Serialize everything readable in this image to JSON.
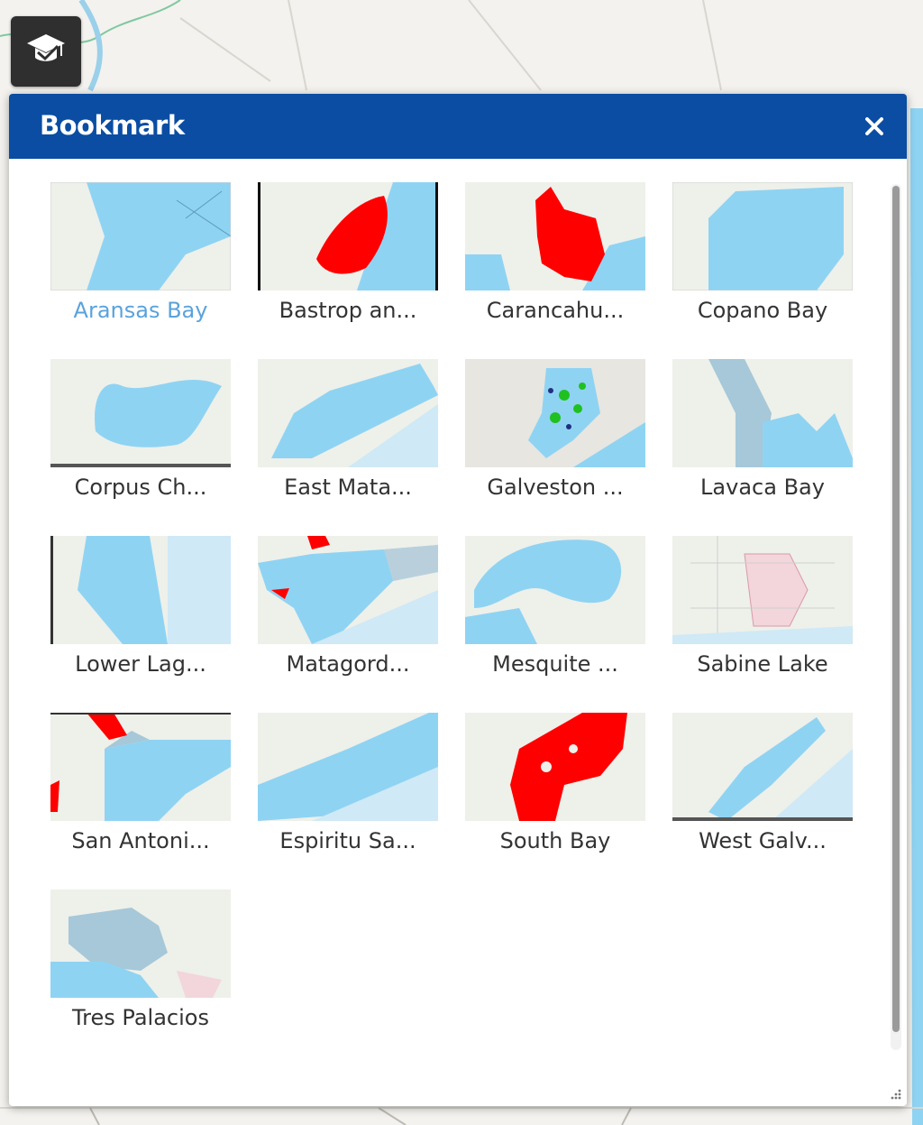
{
  "panel": {
    "title": "Bookmark",
    "close_icon": "close-icon"
  },
  "widget_button": {
    "icon": "graduation-cap-icon"
  },
  "colors": {
    "header": "#0a4da3",
    "water": "#8fd3f3",
    "highlight": "#ff0000",
    "active_label": "#5aa3dc"
  },
  "bookmarks": [
    {
      "label": "Aransas Bay",
      "active": true
    },
    {
      "label": "Bastrop an...",
      "active": false
    },
    {
      "label": "Carancahu...",
      "active": false
    },
    {
      "label": "Copano Bay",
      "active": false
    },
    {
      "label": "Corpus Ch...",
      "active": false
    },
    {
      "label": "East Mata...",
      "active": false
    },
    {
      "label": "Galveston ...",
      "active": false
    },
    {
      "label": "Lavaca Bay",
      "active": false
    },
    {
      "label": "Lower Lag...",
      "active": false
    },
    {
      "label": "Matagord...",
      "active": false
    },
    {
      "label": "Mesquite ...",
      "active": false
    },
    {
      "label": "Sabine Lake",
      "active": false
    },
    {
      "label": "San Antoni...",
      "active": false
    },
    {
      "label": "Espiritu Sa...",
      "active": false
    },
    {
      "label": "South Bay",
      "active": false
    },
    {
      "label": "West Galv...",
      "active": false
    },
    {
      "label": "Tres Palacios",
      "active": false
    }
  ]
}
